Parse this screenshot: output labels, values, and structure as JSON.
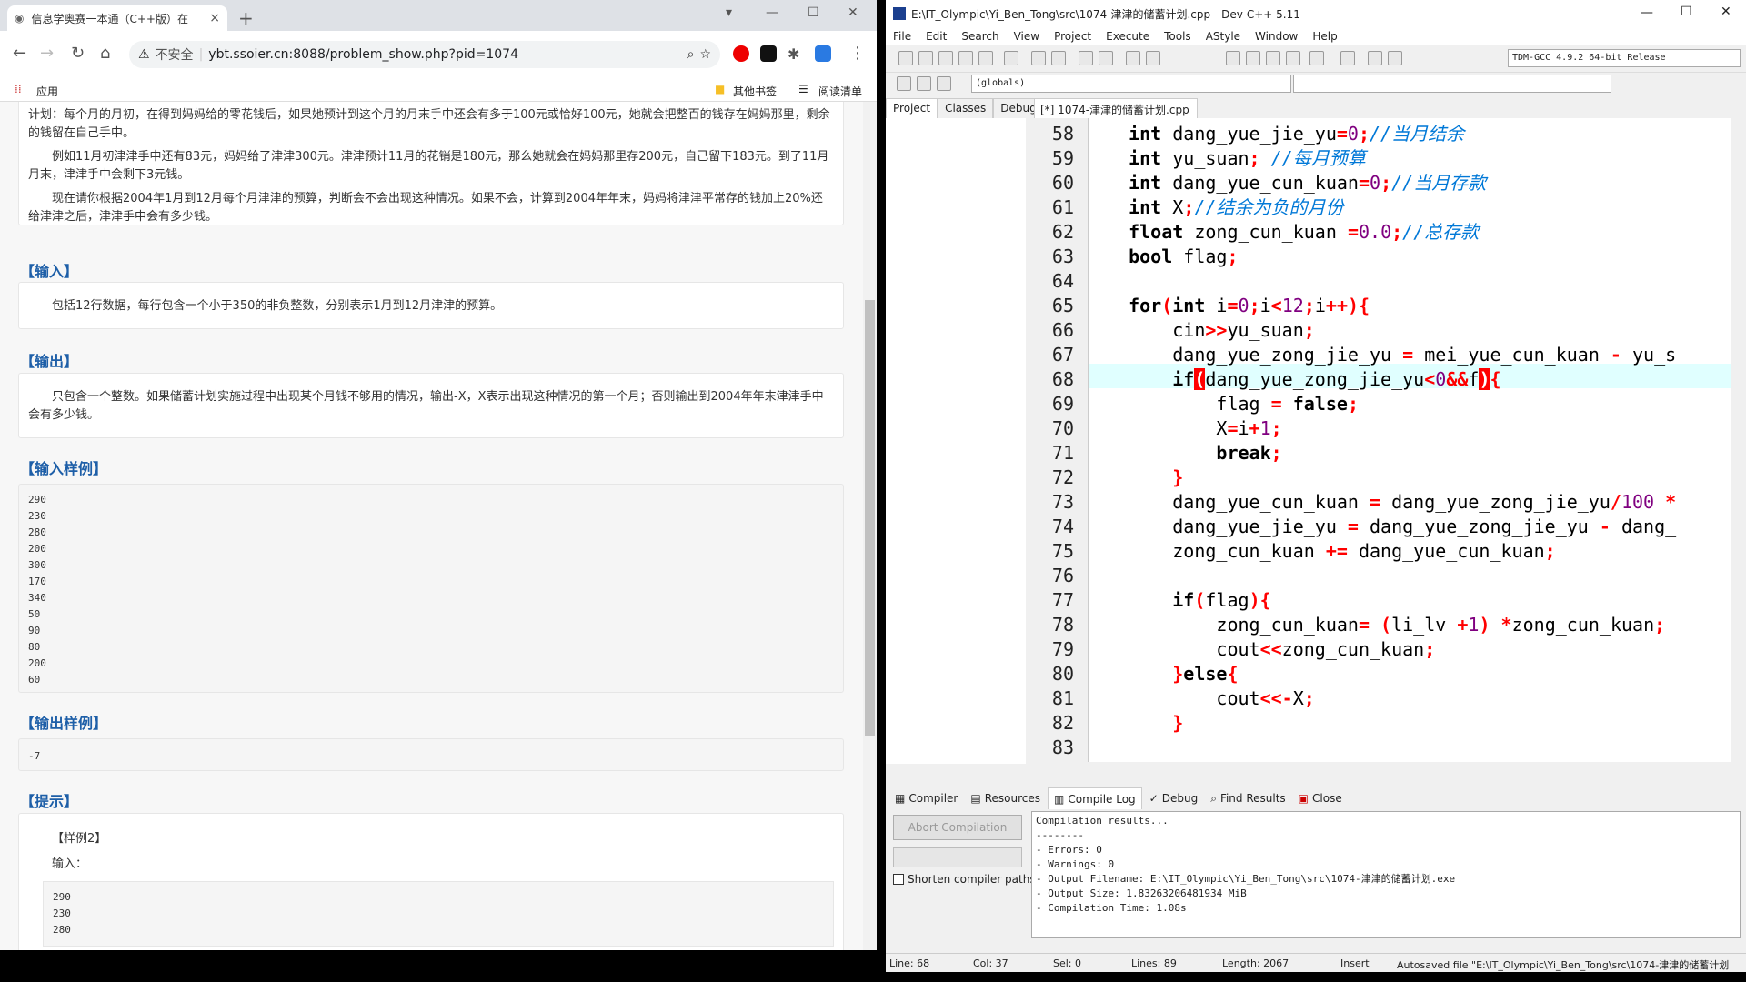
{
  "browser": {
    "tab_title": "信息学奥赛一本通（C++版）在",
    "tab_close": "×",
    "new_tab": "+",
    "nav_back": "←",
    "nav_forward": "→",
    "nav_reload": "↻",
    "nav_home": "⌂",
    "insecure_label": "不安全",
    "url": "ybt.ssoier.cn:8088/problem_show.php?pid=1074",
    "apps_label": "应用",
    "bookmarks_other": "其他书签",
    "reading_list": "阅读清单",
    "problem": {
      "desc_top": "计划：每个月的月初，在得到妈妈给的零花钱后，如果她预计到这个月的月末手中还会有多于100元或恰好100元，她就会把整百的钱存在妈妈那里，剩余的钱留在自己手中。",
      "desc_example": "例如11月初津津手中还有83元，妈妈给了津津300元。津津预计11月的花销是180元，那么她就会在妈妈那里存200元，自己留下183元。到了11月月末，津津手中会剩下3元钱。",
      "desc_task": "现在请你根据2004年1月到12月每个月津津的预算，判断会不会出现这种情况。如果不会，计算到2004年年末，妈妈将津津平常存的钱加上20%还给津津之后，津津手中会有多少钱。",
      "input_title": "【输入】",
      "input_text": "包括12行数据，每行包含一个小于350的非负整数，分别表示1月到12月津津的预算。",
      "output_title": "【输出】",
      "output_text": "只包含一个整数。如果储蓄计划实施过程中出现某个月钱不够用的情况，输出-X，X表示出现这种情况的第一个月；否则输出到2004年年末津津手中会有多少钱。",
      "sample_in_title": "【输入样例】",
      "sample_in": [
        "290",
        "230",
        "280",
        "200",
        "300",
        "170",
        "340",
        "50",
        "90",
        "80",
        "200",
        "60"
      ],
      "sample_out_title": "【输出样例】",
      "sample_out": "-7",
      "hint_title": "【提示】",
      "hint_case": "【样例2】",
      "hint_input_label": "输入：",
      "hint_input": [
        "290",
        "230",
        "280"
      ]
    }
  },
  "ide": {
    "title": "E:\\IT_Olympic\\Yi_Ben_Tong\\src\\1074-津津的储蓄计划.cpp - Dev-C++ 5.11",
    "menu": [
      "File",
      "Edit",
      "Search",
      "View",
      "Project",
      "Execute",
      "Tools",
      "AStyle",
      "Window",
      "Help"
    ],
    "compiler": "TDM-GCC 4.9.2 64-bit Release",
    "scope_combo": "(globals)",
    "left_tabs": [
      "Project",
      "Classes",
      "Debug"
    ],
    "file_tab": "[*] 1074-津津的储蓄计划.cpp",
    "line_numbers": [
      "58",
      "59",
      "60",
      "61",
      "62",
      "63",
      "64",
      "65",
      "66",
      "67",
      "68",
      "69",
      "70",
      "71",
      "72",
      "73",
      "74",
      "75",
      "76",
      "77",
      "78",
      "79",
      "80",
      "81",
      "82",
      "83"
    ],
    "bottom_tabs": [
      "Compiler",
      "Resources",
      "Compile Log",
      "Debug",
      "Find Results",
      "Close"
    ],
    "abort_label": "Abort Compilation",
    "shorten_label": "Shorten compiler paths",
    "log": "Compilation results...\n--------\n- Errors: 0\n- Warnings: 0\n- Output Filename: E:\\IT_Olympic\\Yi_Ben_Tong\\src\\1074-津津的储蓄计划.exe\n- Output Size: 1.83263206481934 MiB\n- Compilation Time: 1.08s",
    "status": {
      "line": "Line:   68",
      "col": "Col:   37",
      "sel": "Sel:   0",
      "lines": "Lines:   89",
      "length": "Length:  2067",
      "mode": "Insert",
      "autosave": "Autosaved file \"E:\\IT_Olympic\\Yi_Ben_Tong\\src\\1074-津津的储蓄计划"
    }
  },
  "colors": {
    "accent": "#1e5fa8",
    "highlight_line": "#e0ffff",
    "brace_match": "#ff0000"
  }
}
